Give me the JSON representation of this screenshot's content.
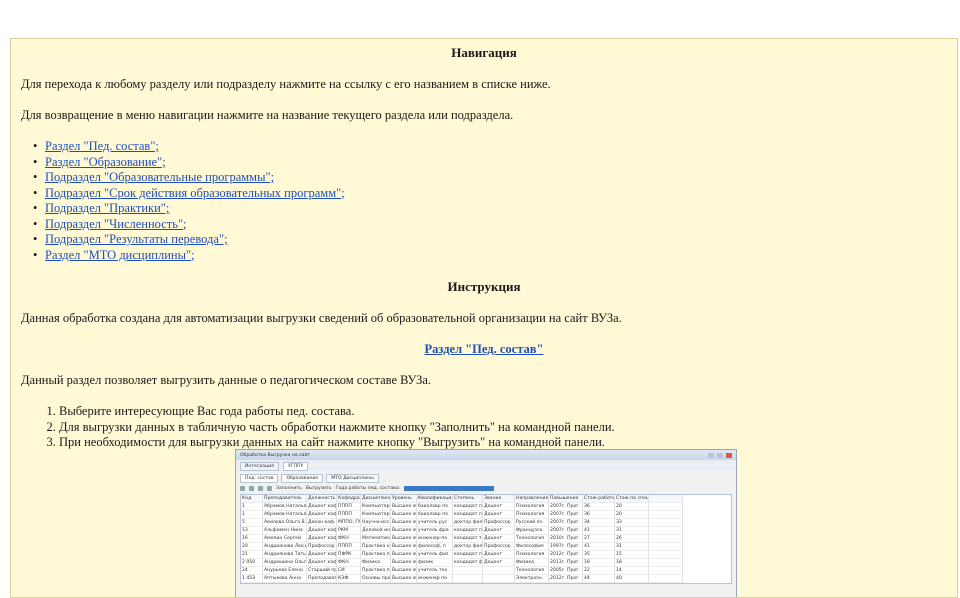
{
  "nav": {
    "heading": "Навигация",
    "intro": "Для перехода к любому разделу или подразделу нажмите на ссылку с его названием в списке ниже.",
    "return_hint": "Для возвращение в меню навигации нажмите на название текущего раздела или подраздела.",
    "links": [
      "Раздел \"Пед. состав\";",
      "Раздел \"Образование\";",
      "Подраздел \"Образовательные программы\";",
      "Подраздел \"Срок действия образовательных программ\";",
      "Подраздел \"Практики\";",
      "Подраздел \"Численность\";",
      "Подраздел \"Результаты перевода\";",
      "Раздел \"МТО дисциплины\";"
    ]
  },
  "instruction": {
    "heading": "Инструкция",
    "purpose": "Данная обработка создана для автоматизации выгрузки сведений об образовательной организации на сайт ВУЗа.",
    "section_link": "Раздел \"Пед. состав\"",
    "section_desc": "Данный раздел позволяет выгрузить данные о педагогическом составе ВУЗа.",
    "steps": [
      "Выберите интересующие Вас  года работы пед. состава.",
      "Для выгрузки данных в табличную часть обработки нажмите кнопку \"Заполнить\" на командной панели.",
      "При необходимости для выгрузки данных на сайт нажмите кнопку \"Выгрузить\" на командной панели."
    ]
  },
  "screenshot": {
    "title": "Обработка  Выгрузка на сайт",
    "tabs": [
      "Интеграция",
      "УГППУ"
    ],
    "subtabs": [
      "Пед. состав",
      "Образование",
      "МТО Дисциплины"
    ],
    "toolbar": [
      "Заполнить",
      "Выгрузить",
      "Года работы пед. состава:"
    ],
    "columns": [
      "Код",
      "Преподаватель",
      "Должность",
      "Кафедра",
      "Дисциплины",
      "Уровень",
      "Квалификация",
      "Степень",
      "Звание",
      "Направление",
      "Повышение",
      "Стаж работы",
      "Стаж по спец.",
      ""
    ],
    "rows": [
      [
        "1",
        "Абрамов Наталья",
        "Доцент каф.",
        "ПППП",
        "Компьютерн.",
        "Высшее обр.",
        "бакалавр по",
        "кандидат пе",
        "Доцент",
        "Психология",
        "2007г. Прог",
        "36",
        "20",
        ""
      ],
      [
        "1",
        "Абрамов Наталья",
        "Доцент каф.",
        "ПППП",
        "Компьютерн.",
        "Высшее обр.",
        "бакалавр по",
        "кандидат пе",
        "Доцент",
        "Психология",
        "2007г. Прог",
        "36",
        "20",
        ""
      ],
      [
        "5",
        "Авилова Ольга В.",
        "Декан каф.",
        "МППО, ГМ",
        "Научно-иссл",
        "Высшее обр.",
        "учитель рус",
        "доктор филол",
        "Профессор",
        "Русский яз.",
        "2007г. Прог",
        "34",
        "33",
        ""
      ],
      [
        "13",
        "Альфимен Нина",
        "Доцент каф.",
        "РКМ",
        "Деловой ин.",
        "Высшее обр.",
        "учитель фра",
        "кандидат пе",
        "Доцент",
        "Французск.",
        "2007г. Прог",
        "41",
        "31",
        ""
      ],
      [
        "16",
        "Амелин Сергей",
        "Доцент каф.",
        "ФКН",
        "Математика",
        "Высшее обр.",
        "инженер-по",
        "кандидат те",
        "Доцент",
        "Технология",
        "2010г. Прог",
        "27",
        "26",
        ""
      ],
      [
        "20",
        "Андрианова Люси",
        "Профессор",
        "ПППП",
        "Практика н.",
        "Высшее обр.",
        "философ, п",
        "доктор филос",
        "Профессор",
        "Философия",
        "1997г. Прог",
        "41",
        "31",
        ""
      ],
      [
        "21",
        "Андриянова Тать",
        "Доцент каф.",
        "ПФРК",
        "Практика п.",
        "Высшее обр.",
        "учитель физ",
        "кандидат пе",
        "Доцент",
        "Психология",
        "2012г. Прог",
        "35",
        "15",
        ""
      ],
      [
        "2 050",
        "Андрюшина Ольга",
        "Доцент каф.",
        "ФКН",
        "Физика",
        "Высшее обр.",
        "физик",
        "кандидат фи",
        "Доцент",
        "Физика",
        "2013г. Прог",
        "18",
        "18",
        ""
      ],
      [
        "24",
        "Анурьева Елена",
        "Старший пр.",
        "СИ",
        "Практика п.",
        "Высшее обр.",
        "учитель тех",
        "",
        "",
        "Технология",
        "2005г. Прог",
        "22",
        "14",
        ""
      ],
      [
        "1 453",
        "Аптыкова Анна",
        "Преподават.",
        "КЭФ",
        "Основы про",
        "Высшее обр.",
        "инженер по",
        "",
        "",
        "Электроэн.",
        "2012г. Прог",
        "44",
        "40",
        ""
      ]
    ]
  }
}
